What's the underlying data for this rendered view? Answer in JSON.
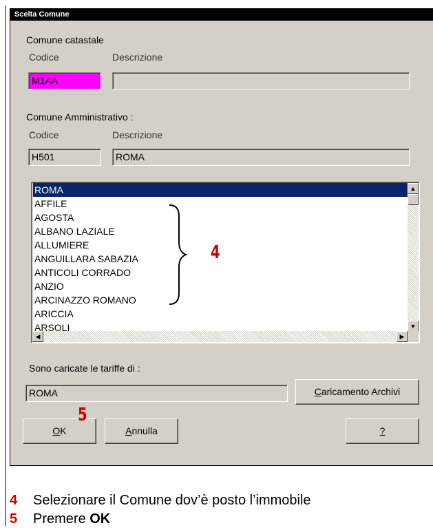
{
  "dialog": {
    "title": "Scelta Comune",
    "catastale": {
      "heading": "Comune catastale",
      "code_label": "Codice",
      "desc_label": "Descrizione",
      "code_value": "M1AA",
      "desc_value": ""
    },
    "amministrativo": {
      "heading": "Comune Amministrativo :",
      "code_label": "Codice",
      "desc_label": "Descrizione",
      "code_value": "H501",
      "desc_value": "ROMA"
    },
    "list": {
      "items": [
        "ROMA",
        "AFFILE",
        "AGOSTA",
        "ALBANO LAZIALE",
        "ALLUMIERE",
        "ANGUILLARA SABAZIA",
        "ANTICOLI CORRADO",
        "ANZIO",
        "ARCINAZZO ROMANO",
        "ARICCIA",
        "ARSOLI"
      ],
      "selected": "ROMA"
    },
    "tariffe": {
      "label": "Sono caricate le tariffe di :",
      "value": "ROMA"
    },
    "buttons": {
      "caricamento_prefix": "C",
      "caricamento_rest": "aricamento Archivi",
      "ok_prefix": "O",
      "ok_rest": "K",
      "annulla_prefix": "A",
      "annulla_rest": "nnulla",
      "help": "?"
    },
    "colors": {
      "pink_field": "#ff00ff",
      "selection": "#0a246a",
      "dialog_bg": "#d4d0c8",
      "annotation": "#cc0000"
    }
  },
  "annotations": {
    "list_marker": "4",
    "ok_marker": "5"
  },
  "notes": [
    {
      "number": "4",
      "text_plain": "Selezionare il Comune dov’è posto l’immobile"
    },
    {
      "number": "5",
      "text_plain": "Premere ",
      "text_bold": "OK"
    }
  ]
}
